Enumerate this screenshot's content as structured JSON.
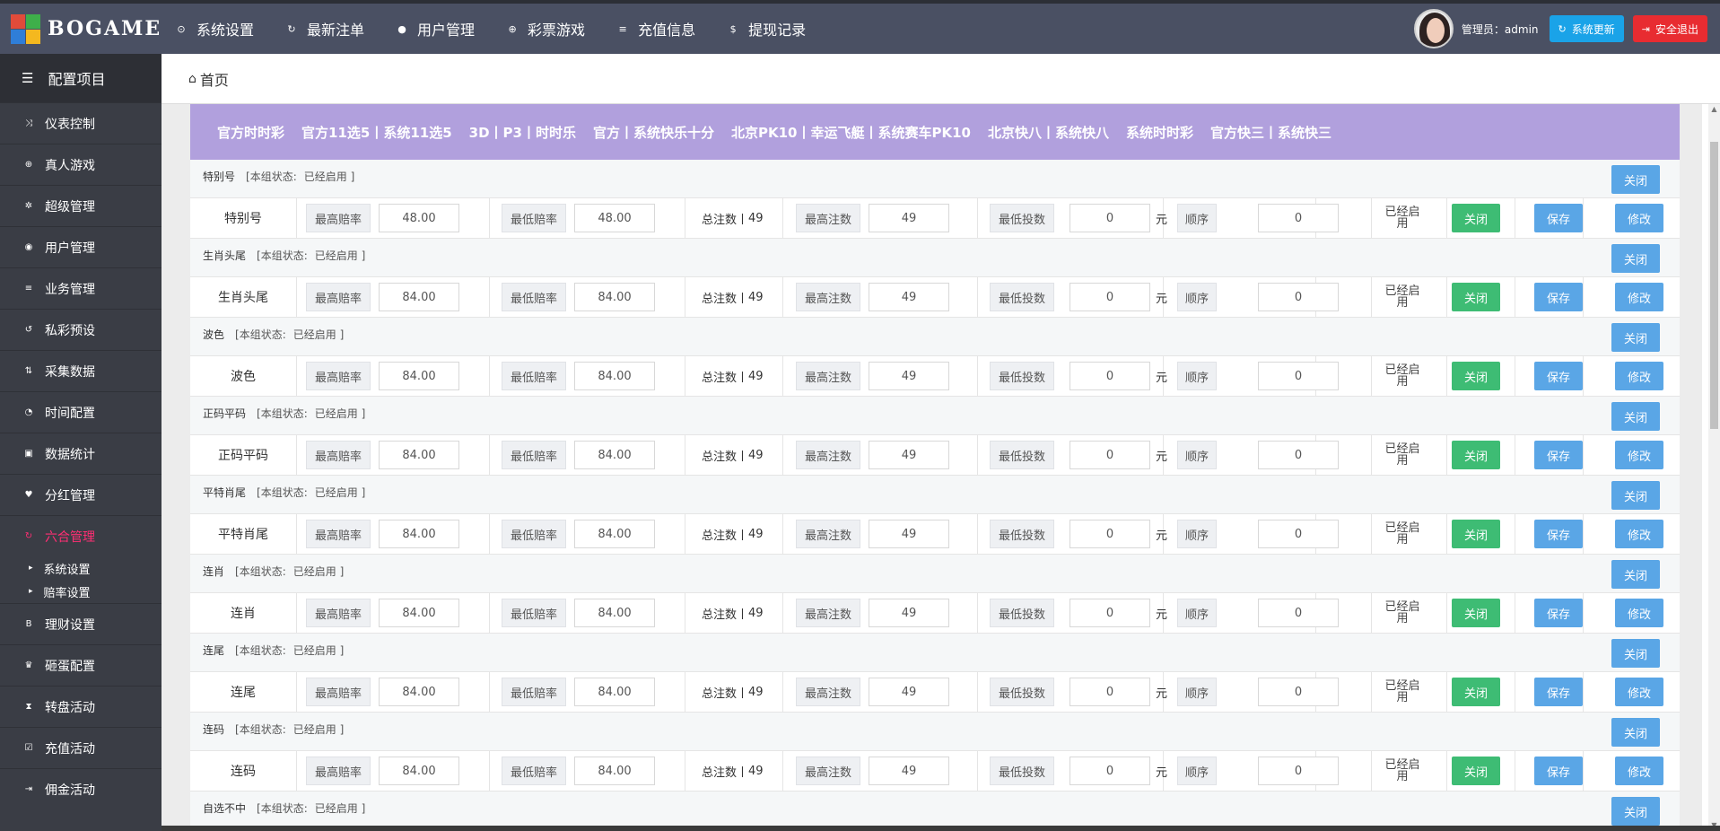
{
  "app": {
    "logo_text": "BOGAME",
    "logo_colors": [
      "#e14b3a",
      "#3eaf4a",
      "#2f7ed8",
      "#f4b81f"
    ]
  },
  "topnav": [
    {
      "icon": "toggle-icon",
      "glyph": "⊙",
      "label": "系统设置"
    },
    {
      "icon": "refresh-icon",
      "glyph": "↻",
      "label": "最新注单"
    },
    {
      "icon": "user-icon",
      "glyph": "●",
      "label": "用户管理"
    },
    {
      "icon": "plus-circle-icon",
      "glyph": "⊕",
      "label": "彩票游戏"
    },
    {
      "icon": "list-icon",
      "glyph": "≡",
      "label": "充值信息"
    },
    {
      "icon": "dollar-icon",
      "glyph": "$",
      "label": "提现记录"
    }
  ],
  "header": {
    "admin_label": "管理员：admin",
    "update_label": "系统更新",
    "logout_label": "安全退出",
    "colors": {
      "topbar": "#4a5063",
      "update": "#1aa3e8",
      "logout": "#e82c31"
    }
  },
  "sidebar": {
    "title": "配置项目",
    "items": [
      {
        "icon": "shuffle-icon",
        "glyph": "⤨",
        "label": "仪表控制"
      },
      {
        "icon": "plus-circle-icon",
        "glyph": "⊕",
        "label": "真人游戏"
      },
      {
        "icon": "gear-icon",
        "glyph": "✲",
        "label": "超级管理"
      },
      {
        "icon": "user-circle-icon",
        "glyph": "◉",
        "label": "用户管理"
      },
      {
        "icon": "bars-icon",
        "glyph": "≡",
        "label": "业务管理"
      },
      {
        "icon": "history-icon",
        "glyph": "↺",
        "label": "私彩预设"
      },
      {
        "icon": "sort-icon",
        "glyph": "⇅",
        "label": "采集数据"
      },
      {
        "icon": "dashboard-icon",
        "glyph": "◔",
        "label": "时间配置"
      },
      {
        "icon": "chart-icon",
        "glyph": "▣",
        "label": "数据统计"
      },
      {
        "icon": "heart-icon",
        "glyph": "♥",
        "label": "分红管理"
      },
      {
        "icon": "refresh-icon",
        "glyph": "↻",
        "label": "六合管理",
        "active": true
      }
    ],
    "sub_items": [
      {
        "label": "系统设置"
      },
      {
        "label": "赔率设置"
      }
    ],
    "items_after": [
      {
        "icon": "bitcoin-icon",
        "glyph": "B",
        "label": "理财设置"
      },
      {
        "icon": "trophy-icon",
        "glyph": "♛",
        "label": "砸蛋配置"
      },
      {
        "icon": "hourglass-icon",
        "glyph": "⧗",
        "label": "转盘活动"
      },
      {
        "icon": "checkbox-icon",
        "glyph": "☑",
        "label": "充值活动"
      },
      {
        "icon": "signin-icon",
        "glyph": "⇥",
        "label": "佣金活动"
      }
    ],
    "active_color": "#ff2e73"
  },
  "breadcrumb": {
    "icon": "home-icon",
    "label": "首页"
  },
  "tabs": [
    "官方时时彩",
    "官方11选5丨系统11选5",
    "3D丨P3丨时时乐",
    "官方丨系统快乐十分",
    "北京PK10丨幸运飞艇丨系统赛车PK10",
    "北京快八丨系统快八",
    "系统时时彩",
    "官方快三丨系统快三"
  ],
  "labels": {
    "max_odds": "最高赔率",
    "min_odds": "最低赔率",
    "total_prefix": "总注数丨",
    "max_bets": "最高注数",
    "min_stake": "最低投数",
    "currency": "元",
    "order": "顺序",
    "enabled_line1": "已经启",
    "enabled_line2": "用",
    "close": "关闭",
    "save": "保存",
    "edit": "修改",
    "status_prefix": "[本组状态:",
    "status_value": "已经启用 ]"
  },
  "groups": [
    {
      "name": "特别号",
      "max_odds": "48.00",
      "min_odds": "48.00",
      "total": "49",
      "max_bets": "49",
      "min_stake": "0",
      "order": "0"
    },
    {
      "name": "生肖头尾",
      "max_odds": "84.00",
      "min_odds": "84.00",
      "total": "49",
      "max_bets": "49",
      "min_stake": "0",
      "order": "0"
    },
    {
      "name": "波色",
      "max_odds": "84.00",
      "min_odds": "84.00",
      "total": "49",
      "max_bets": "49",
      "min_stake": "0",
      "order": "0"
    },
    {
      "name": "正码平码",
      "max_odds": "84.00",
      "min_odds": "84.00",
      "total": "49",
      "max_bets": "49",
      "min_stake": "0",
      "order": "0"
    },
    {
      "name": "平特肖尾",
      "max_odds": "84.00",
      "min_odds": "84.00",
      "total": "49",
      "max_bets": "49",
      "min_stake": "0",
      "order": "0"
    },
    {
      "name": "连肖",
      "max_odds": "84.00",
      "min_odds": "84.00",
      "total": "49",
      "max_bets": "49",
      "min_stake": "0",
      "order": "0"
    },
    {
      "name": "连尾",
      "max_odds": "84.00",
      "min_odds": "84.00",
      "total": "49",
      "max_bets": "49",
      "min_stake": "0",
      "order": "0"
    },
    {
      "name": "连码",
      "max_odds": "84.00",
      "min_odds": "84.00",
      "total": "49",
      "max_bets": "49",
      "min_stake": "0",
      "order": "0"
    },
    {
      "name": "自选不中"
    }
  ],
  "colors": {
    "tabbar": "#b1a0dd",
    "green": "#3ebc74",
    "blue": "#5aa6e6"
  }
}
